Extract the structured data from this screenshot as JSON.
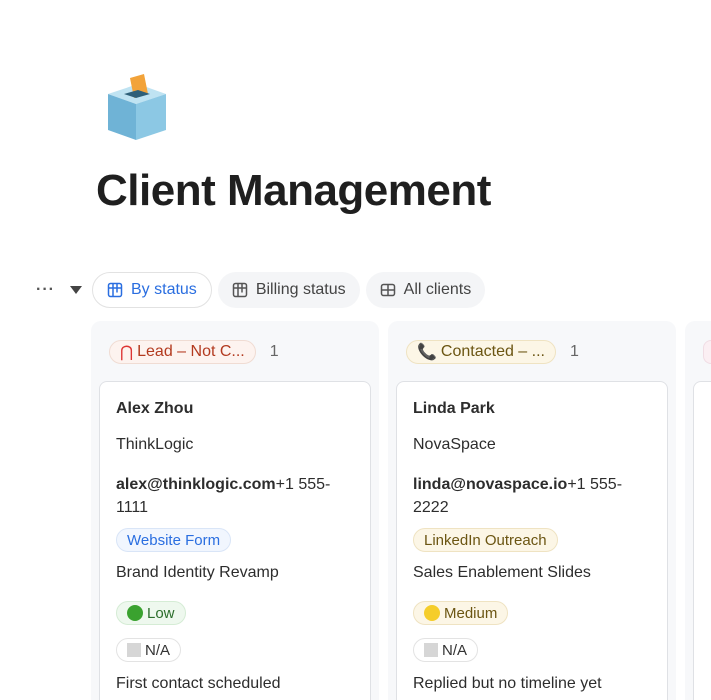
{
  "page": {
    "title": "Client Management"
  },
  "toolbar": {
    "more_label": "···",
    "tabs": [
      {
        "label": "By status"
      },
      {
        "label": "Billing status"
      },
      {
        "label": "All clients"
      }
    ]
  },
  "columns": [
    {
      "status": "Lead – Not C...",
      "count": "1",
      "status_color": "#b33a1f",
      "status_bg": "#fdf3ef",
      "card": {
        "name": "Alex Zhou",
        "company": "ThinkLogic",
        "email": "alex@thinklogic.com",
        "phone": "+1 555-1111",
        "source": "Website Form",
        "project": "Brand Identity Revamp",
        "priority": "Low",
        "billing": "N/A",
        "note": "First contact scheduled"
      }
    },
    {
      "status": "Contacted – ...",
      "count": "1",
      "status_color": "#6b5512",
      "status_bg": "#fcf6e6",
      "card": {
        "name": "Linda Park",
        "company": "NovaSpace",
        "email": "linda@novaspace.io",
        "phone": "+1 555-2222",
        "source": "LinkedIn Outreach",
        "project": "Sales Enablement Slides",
        "priority": "Medium",
        "billing": "N/A",
        "note": "Replied but no timeline yet"
      }
    }
  ]
}
